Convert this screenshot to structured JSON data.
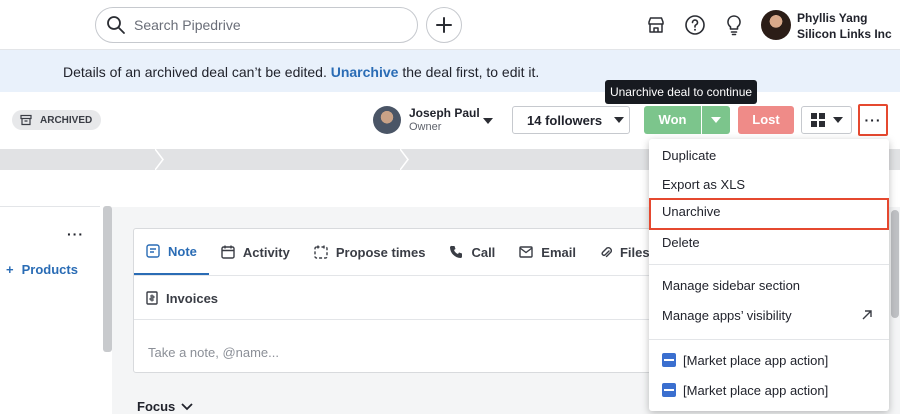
{
  "topbar": {
    "search_placeholder": "Search Pipedrive",
    "user_name": "Phyllis Yang",
    "company": "Silicon Links Inc",
    "icons": [
      "search-icon",
      "plus-icon",
      "marketplace-icon",
      "help-icon",
      "lightbulb-icon"
    ]
  },
  "banner": {
    "prefix": "Details of an archived deal can’t be edited.",
    "link": "Unarchive",
    "suffix": "the deal first, to edit it."
  },
  "deal_header": {
    "status_badge": "ARCHIVED",
    "owner_name": "Joseph Paul",
    "owner_role": "Owner",
    "followers": "14 followers",
    "won": "Won",
    "lost": "Lost",
    "more": "···",
    "tooltip": "Unarchive deal to continue"
  },
  "menu": {
    "items": [
      "Duplicate",
      "Export as XLS",
      "Unarchive",
      "Delete",
      "Manage sidebar section",
      "Manage apps’ visibility",
      "[Market place app action]",
      "[Market place app action]"
    ]
  },
  "sidebar": {
    "more": "···",
    "products": "Products"
  },
  "composer": {
    "tabs": [
      "Note",
      "Activity",
      "Propose times",
      "Call",
      "Email",
      "Files"
    ],
    "tab_row2": [
      "Invoices"
    ],
    "placeholder": "Take a note, @name..."
  },
  "main": {
    "focus": "Focus"
  },
  "colors": {
    "accent_blue": "#2a6cb5",
    "won_green": "#7cc58c",
    "lost_red": "#ef8b88",
    "highlight_red": "#e5482f"
  }
}
